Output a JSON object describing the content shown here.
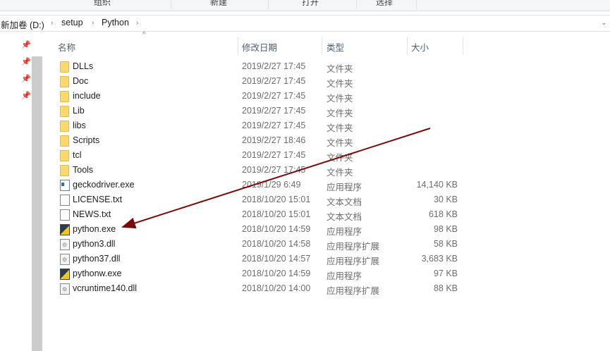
{
  "ribbon": {
    "groups": [
      "组织",
      "新建",
      "打开",
      "选择"
    ]
  },
  "breadcrumb": [
    "新加卷 (D:)",
    "setup",
    "Python"
  ],
  "columns": {
    "name": "名称",
    "date": "修改日期",
    "type": "类型",
    "size": "大小"
  },
  "files": [
    {
      "name": "DLLs",
      "date": "2019/2/27 17:45",
      "type": "文件夹",
      "size": "",
      "icon": "folder"
    },
    {
      "name": "Doc",
      "date": "2019/2/27 17:45",
      "type": "文件夹",
      "size": "",
      "icon": "folder"
    },
    {
      "name": "include",
      "date": "2019/2/27 17:45",
      "type": "文件夹",
      "size": "",
      "icon": "folder"
    },
    {
      "name": "Lib",
      "date": "2019/2/27 17:45",
      "type": "文件夹",
      "size": "",
      "icon": "folder"
    },
    {
      "name": "libs",
      "date": "2019/2/27 17:45",
      "type": "文件夹",
      "size": "",
      "icon": "folder"
    },
    {
      "name": "Scripts",
      "date": "2019/2/27 18:46",
      "type": "文件夹",
      "size": "",
      "icon": "folder"
    },
    {
      "name": "tcl",
      "date": "2019/2/27 17:45",
      "type": "文件夹",
      "size": "",
      "icon": "folder"
    },
    {
      "name": "Tools",
      "date": "2019/2/27 17:45",
      "type": "文件夹",
      "size": "",
      "icon": "folder"
    },
    {
      "name": "geckodriver.exe",
      "date": "2019/1/29 6:49",
      "type": "应用程序",
      "size": "14,140 KB",
      "icon": "app"
    },
    {
      "name": "LICENSE.txt",
      "date": "2018/10/20 15:01",
      "type": "文本文档",
      "size": "30 KB",
      "icon": "file"
    },
    {
      "name": "NEWS.txt",
      "date": "2018/10/20 15:01",
      "type": "文本文档",
      "size": "618 KB",
      "icon": "file"
    },
    {
      "name": "python.exe",
      "date": "2018/10/20 14:59",
      "type": "应用程序",
      "size": "98 KB",
      "icon": "py"
    },
    {
      "name": "python3.dll",
      "date": "2018/10/20 14:58",
      "type": "应用程序扩展",
      "size": "58 KB",
      "icon": "dll"
    },
    {
      "name": "python37.dll",
      "date": "2018/10/20 14:57",
      "type": "应用程序扩展",
      "size": "3,683 KB",
      "icon": "dll"
    },
    {
      "name": "pythonw.exe",
      "date": "2018/10/20 14:59",
      "type": "应用程序",
      "size": "97 KB",
      "icon": "py"
    },
    {
      "name": "vcruntime140.dll",
      "date": "2018/10/20 14:00",
      "type": "应用程序扩展",
      "size": "88 KB",
      "icon": "dll"
    }
  ],
  "annotation_color": "#7a0a0a"
}
